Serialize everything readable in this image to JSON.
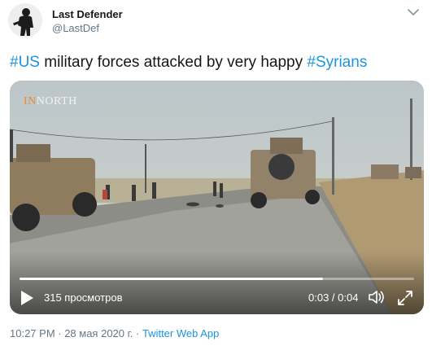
{
  "author": {
    "name": "Last Defender",
    "handle": "@LastDef"
  },
  "tweet": {
    "hashtag1": "#US",
    "text_middle": " military forces attacked by very happy ",
    "hashtag2": "#Syrians"
  },
  "video": {
    "watermark_prefix": "IN",
    "watermark_accent": "N",
    "watermark_suffix": "ORTH",
    "views": "315 просмотров",
    "time": "0:03 / 0:04",
    "progress": 0.77
  },
  "footer": {
    "timestamp": "10:27 PM · 28 мая 2020 г.",
    "separator": " · ",
    "source": "Twitter Web App"
  },
  "colors": {
    "link": "#1b95e0",
    "secondary_text": "#657786",
    "primary_text": "#14171a"
  },
  "icons": {
    "more": "chevron-down-icon",
    "play": "play-icon",
    "volume": "volume-icon",
    "fullscreen": "fullscreen-icon"
  }
}
